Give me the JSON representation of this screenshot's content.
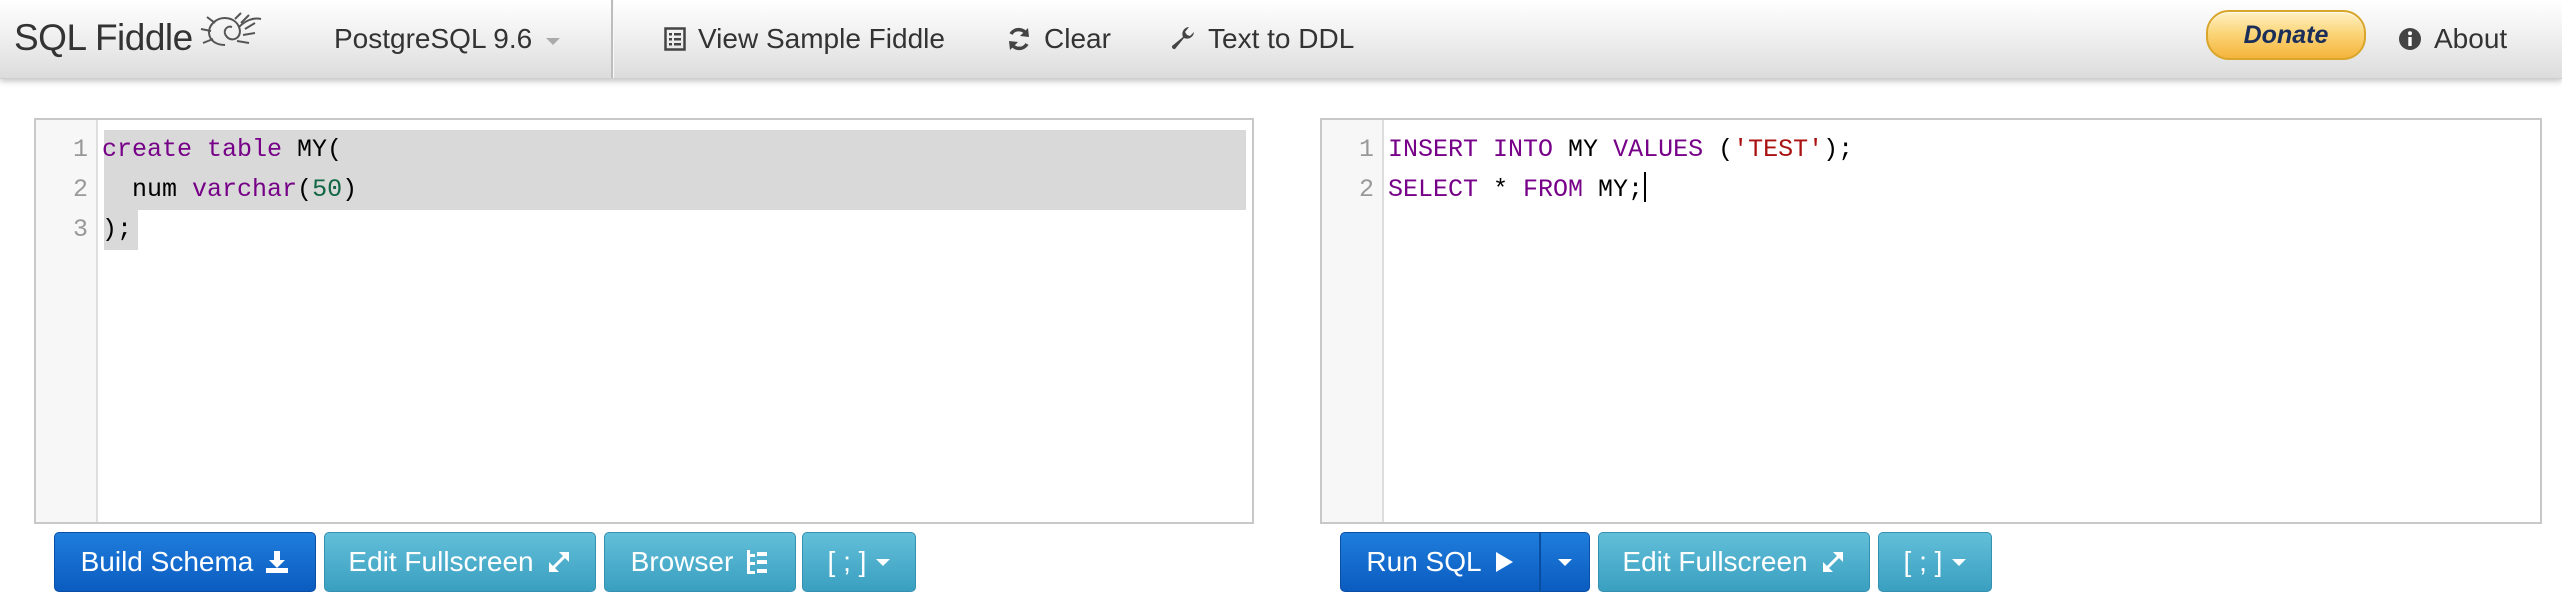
{
  "navbar": {
    "brand": "SQL Fiddle",
    "db_select": "PostgreSQL 9.6",
    "view_sample": "View Sample Fiddle",
    "clear": "Clear",
    "text_to_ddl": "Text to DDL",
    "donate": "Donate",
    "about": "About"
  },
  "schema_panel": {
    "line_numbers": [
      "1",
      "2",
      "3"
    ],
    "lines": [
      [
        {
          "t": "create",
          "c": "kw"
        },
        {
          "t": " ",
          "c": ""
        },
        {
          "t": "table",
          "c": "kw"
        },
        {
          "t": " MY(",
          "c": ""
        }
      ],
      [
        {
          "t": "  num ",
          "c": ""
        },
        {
          "t": "varchar",
          "c": "kw"
        },
        {
          "t": "(",
          "c": ""
        },
        {
          "t": "50",
          "c": "num"
        },
        {
          "t": ")",
          "c": ""
        }
      ],
      [
        {
          "t": ");",
          "c": ""
        }
      ]
    ],
    "buttons": {
      "build_schema": "Build Schema",
      "edit_fullscreen": "Edit Fullscreen",
      "browser": "Browser",
      "terminator": "[ ; ]"
    }
  },
  "query_panel": {
    "line_numbers": [
      "1",
      "2"
    ],
    "lines": [
      [
        {
          "t": "INSERT",
          "c": "kw"
        },
        {
          "t": " ",
          "c": ""
        },
        {
          "t": "INTO",
          "c": "kw"
        },
        {
          "t": " MY ",
          "c": ""
        },
        {
          "t": "VALUES",
          "c": "kw"
        },
        {
          "t": " (",
          "c": ""
        },
        {
          "t": "'TEST'",
          "c": "str"
        },
        {
          "t": ");",
          "c": ""
        }
      ],
      [
        {
          "t": "SELECT",
          "c": "kw"
        },
        {
          "t": " * ",
          "c": ""
        },
        {
          "t": "FROM",
          "c": "kw"
        },
        {
          "t": " MY;",
          "c": ""
        }
      ]
    ],
    "buttons": {
      "run_sql": "Run SQL",
      "edit_fullscreen": "Edit Fullscreen",
      "terminator": "[ ; ]"
    }
  },
  "colors": {
    "keyword": "#770088",
    "string": "#aa1111",
    "number": "#116644",
    "primary_button": "#0b5cc0",
    "info_button": "#3a9fc0",
    "selection": "#d9d9d9"
  },
  "icons": {
    "brand_logo": "nautilus-shell-icon",
    "view_sample": "list-icon",
    "clear": "refresh-icon",
    "text_to_ddl": "wrench-icon",
    "about": "info-circle-icon",
    "build_schema": "download-icon",
    "edit_fullscreen": "expand-icon",
    "browser": "tree-icon",
    "run_sql": "play-icon"
  }
}
